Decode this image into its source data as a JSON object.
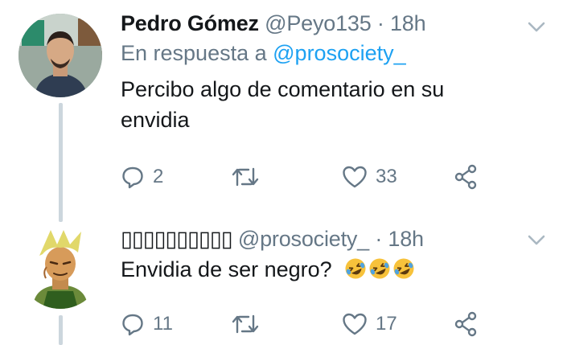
{
  "tweets": [
    {
      "author_name": "Pedro Gómez",
      "handle": "@Peyo135",
      "separator": "·",
      "time": "18h",
      "reply_prefix": "En respuesta a",
      "reply_mention": "@prosociety_",
      "text": "Percibo algo de comentario en su envidia",
      "actions": {
        "reply_count": "2",
        "retweet_count": "",
        "like_count": "33"
      }
    },
    {
      "author_name": "▯▯▯▯▯▯▯▯▯▯",
      "handle": "@prosociety_",
      "separator": "·",
      "time": "18h",
      "text": "Envidia de ser negro?",
      "emoji": "🤣🤣🤣",
      "actions": {
        "reply_count": "11",
        "retweet_count": "",
        "like_count": "17"
      }
    }
  ],
  "colors": {
    "text": "#14171a",
    "secondary": "#657786",
    "link": "#1da1f2",
    "thread_line": "#ccd6dd"
  },
  "icons": {
    "reply": "speech-bubble-icon",
    "retweet": "retweet-arrows-icon",
    "like": "heart-outline-icon",
    "share": "share-nodes-icon",
    "menu": "chevron-down-icon"
  }
}
